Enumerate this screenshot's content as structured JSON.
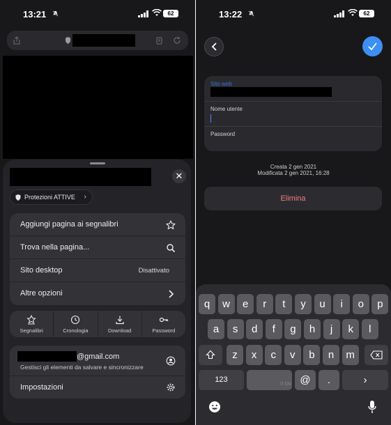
{
  "left": {
    "status": {
      "time": "13:21",
      "battery": "62"
    },
    "protections": {
      "label": "Protezioni ATTIVE",
      "icon": "shield-icon"
    },
    "menu": [
      {
        "label": "Aggiungi pagina ai segnalibri",
        "icon": "star-icon"
      },
      {
        "label": "Trova nella pagina...",
        "icon": "search-icon"
      },
      {
        "label": "Sito desktop",
        "value": "Disattivato"
      },
      {
        "label": "Altre opzioni",
        "icon": "chevron-right-icon"
      }
    ],
    "quick_actions": [
      {
        "label": "Segnalibri",
        "icon": "bookmarks-icon"
      },
      {
        "label": "Cronologia",
        "icon": "clock-icon"
      },
      {
        "label": "Download",
        "icon": "download-icon"
      },
      {
        "label": "Password",
        "icon": "key-icon"
      }
    ],
    "account": {
      "email_suffix": "@gmail.com",
      "subtitle": "Gestisci gli elementi da salvare e sincronizzare",
      "settings_label": "Impostazioni"
    }
  },
  "right": {
    "status": {
      "time": "13:22",
      "battery": "62"
    },
    "form": {
      "website_label": "Sito web",
      "username_label": "Nome utente",
      "password_label": "Password"
    },
    "meta": {
      "created": "Creata 2 gen 2021",
      "modified": "Modificata 2 gen 2021, 16:28"
    },
    "delete_label": "Elimina",
    "keyboard": {
      "row1": [
        "q",
        "w",
        "e",
        "r",
        "t",
        "y",
        "u",
        "i",
        "o",
        "p"
      ],
      "row2": [
        "a",
        "s",
        "d",
        "f",
        "g",
        "h",
        "j",
        "k",
        "l"
      ],
      "row3": [
        "z",
        "x",
        "c",
        "v",
        "b",
        "n",
        "m"
      ],
      "numbers_key": "123",
      "at_key": "@",
      "dot_key": ".",
      "return_key": "›",
      "space_language": "IT EN"
    }
  },
  "colors": {
    "accent": "#3d8ff3",
    "danger": "#f27c7c",
    "sheet": "#242428",
    "group": "#333337"
  }
}
